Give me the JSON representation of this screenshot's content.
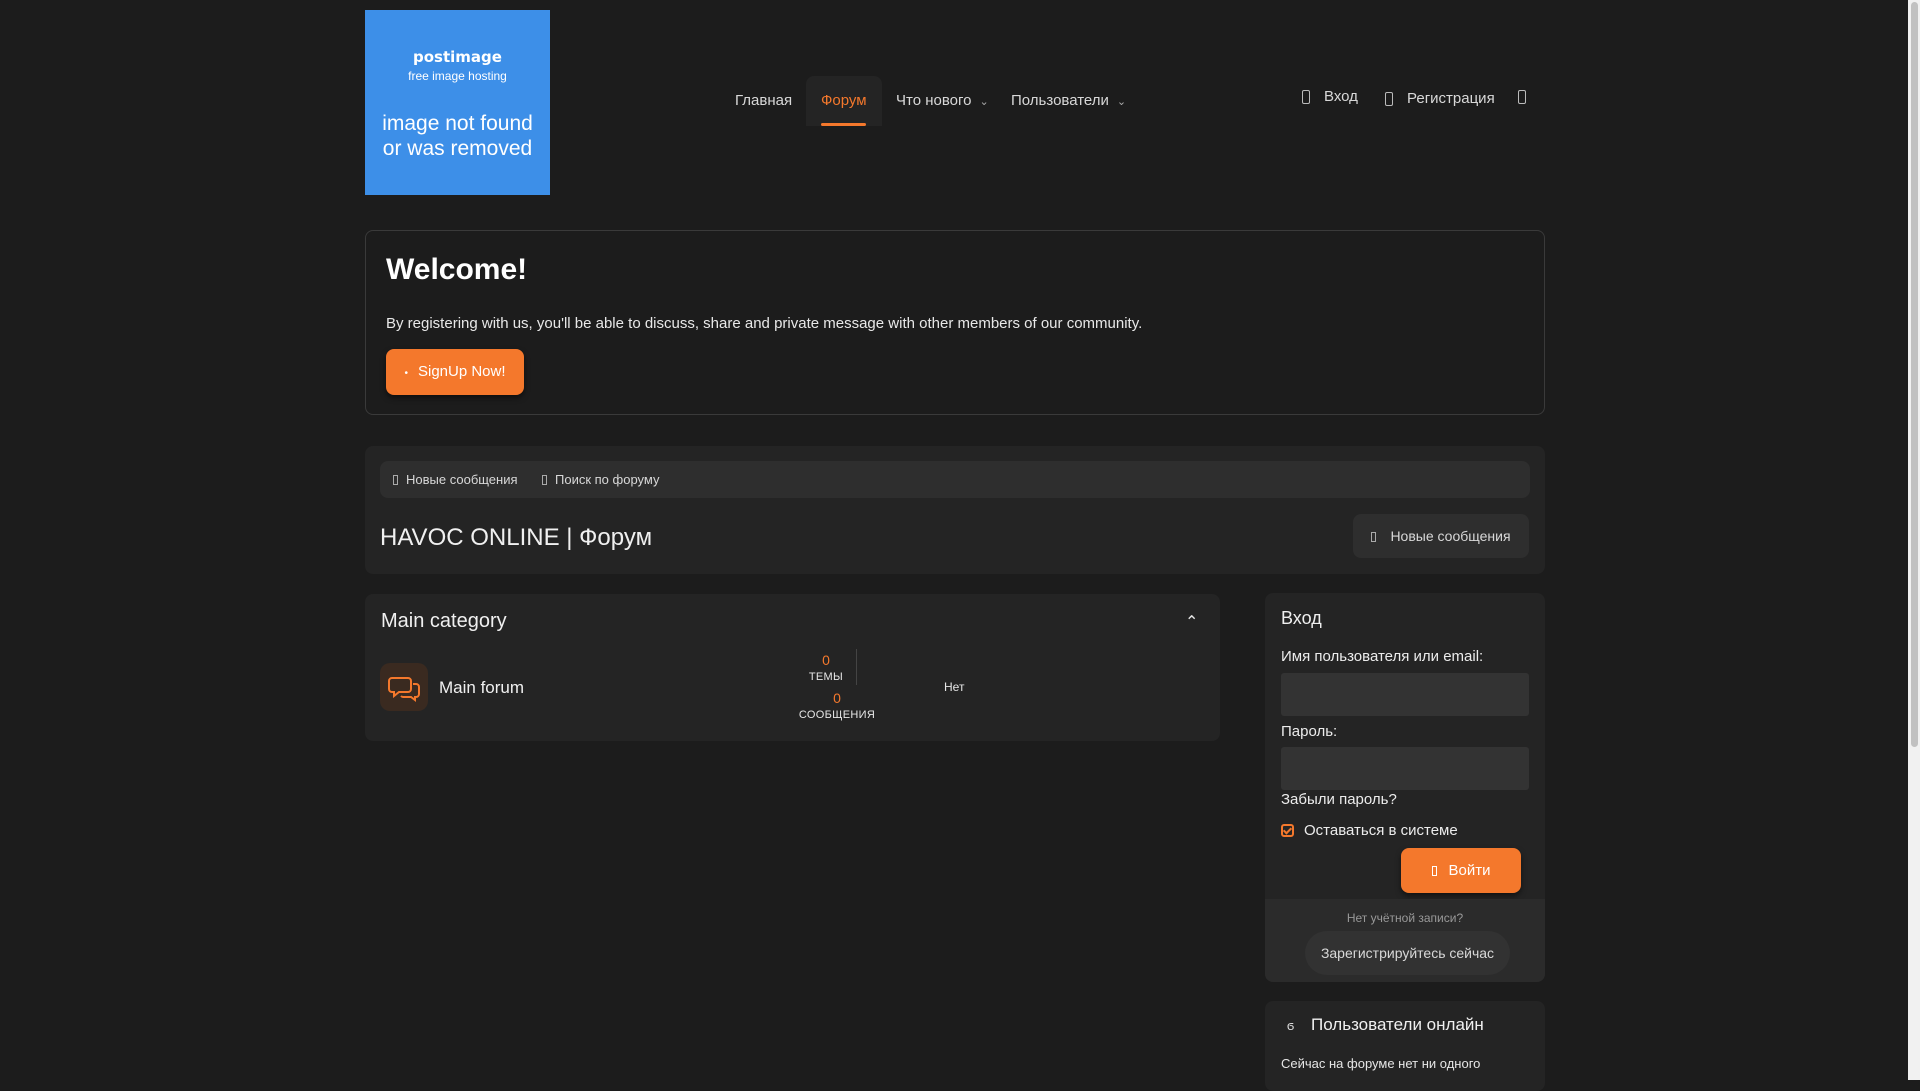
{
  "logo": {
    "brand": "postimage",
    "tagline": "free image hosting",
    "message_line1": "image not found",
    "message_line2": "or was removed"
  },
  "nav": {
    "home": "Главная",
    "forum": "Форум",
    "whats_new": "Что нового",
    "members": "Пользователи",
    "login": "Вход",
    "register": "Регистрация"
  },
  "welcome": {
    "title": "Welcome!",
    "text": "By registering with us, you'll be able to discuss, share and private message with other members of our community.",
    "button": "SignUp Now!"
  },
  "forum_header": {
    "new_posts_link": "Новые сообщения",
    "search_link": "Поиск по форуму",
    "title": "HAVOC ONLINE | Форум",
    "new_posts_button": "Новые сообщения"
  },
  "category": {
    "title": "Main category",
    "forum": {
      "name": "Main forum",
      "threads_count": "0",
      "threads_label": "ТЕМЫ",
      "messages_count": "0",
      "messages_label": "СООБЩЕНИЯ",
      "last_post": "Нет"
    }
  },
  "login": {
    "title": "Вход",
    "username_label": "Имя пользователя или email:",
    "password_label": "Пароль:",
    "forgot": "Забыли пароль?",
    "remember": "Оставаться в системе",
    "submit": "Войти",
    "no_account": "Нет учётной записи?",
    "register_now": "Зарегистрируйтесь сейчас"
  },
  "online": {
    "title": "Пользователи онлайн",
    "text": "Сейчас на форуме нет ни одного"
  },
  "colors": {
    "accent": "#f4782c",
    "background": "#1c1c1c",
    "panel": "#242424"
  }
}
